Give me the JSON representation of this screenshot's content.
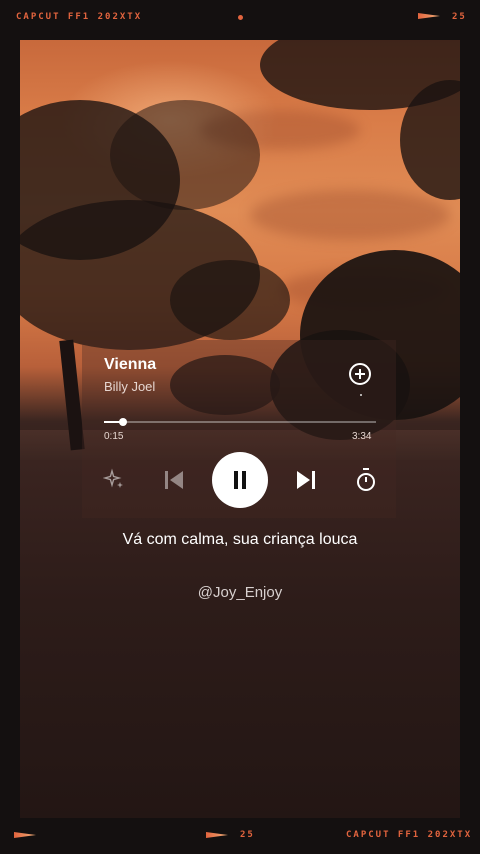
{
  "film": {
    "top_left": "CAPCUT  FF1 202XTX",
    "top_right": "25",
    "bottom_center": "25",
    "bottom_right": "CAPCUT  FF1 202XTX"
  },
  "track": {
    "title": "Vienna",
    "artist": "Billy Joel",
    "elapsed": "0:15",
    "duration": "3:34",
    "progress": 0.07
  },
  "controls": {
    "shuffle_icon": "sparkle-icon",
    "prev_icon": "skip-back-icon",
    "play_icon": "pause-icon",
    "next_icon": "skip-forward-icon",
    "timer_icon": "sleep-timer-icon",
    "add_icon": "add-circle-icon"
  },
  "lyric": "Vá com calma, sua criança louca",
  "handle": "@Joy_Enjoy",
  "colors": {
    "accent": "#e2643e",
    "sky": "#e08c55",
    "background": "#141010"
  }
}
